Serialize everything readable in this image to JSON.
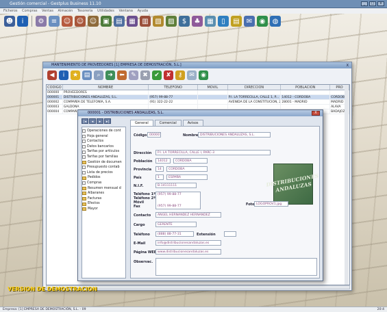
{
  "app": {
    "title": "Gestión comercial - Gestplus Business 11.10",
    "menu": [
      "Ficheros",
      "Compras",
      "Ventas",
      "Almacén",
      "Tesorería",
      "Utilidades",
      "Ventana",
      "Ayuda"
    ]
  },
  "list_window": {
    "title": "MANTENIMIENTO DE PROVEEDORES     [1] EMPRESA DE DEMOSTRACIÓN, S.L.]",
    "close": "X",
    "columns": [
      "CODIGO",
      "NOMBRE",
      "TELEFONO",
      "MOVIL",
      "DIRECCION",
      "POBLACION",
      "PRO"
    ],
    "rows": [
      [
        "000000",
        "PROVEEDORES",
        "",
        "",
        "",
        "",
        ""
      ],
      [
        "000001",
        "DISTRIBUCIONES ANDALUZAS, S.L.",
        "(957) 99-88-77",
        "",
        "P.I. LA TORRECILLA, CALLE 1, P...",
        "14012 - CORDOBA",
        "CORDOBA"
      ],
      [
        "000002",
        "COMPAÑÍA DE TELEFONÍA, S.A.",
        "(91) 322-22-22",
        "",
        "AVENIDA DE LA CONSTITUCION, 2",
        "28001 - MADRID",
        "MADRID"
      ],
      [
        "000003",
        "GALDONA",
        "",
        "",
        "",
        "",
        "ALAVA"
      ],
      [
        "000004",
        "COMPAÑ",
        "",
        "",
        "",
        "",
        "BADAJOZ"
      ]
    ]
  },
  "detail_window": {
    "title": "000001 - DISTRIBUCIONES ANDALUZAS, S.L.",
    "close": "X",
    "nav": [
      "|◂",
      "◂",
      "▸",
      "▸|"
    ],
    "tabs": [
      "General",
      "Comercial",
      "Avisos"
    ],
    "tree": [
      {
        "label": "Operaciones de cont",
        "type": "doc"
      },
      {
        "label": "Hoja general",
        "type": "doc"
      },
      {
        "label": "Contactos",
        "type": "doc"
      },
      {
        "label": "Datos bancarios",
        "type": "doc"
      },
      {
        "label": "Tarifas por artículos",
        "type": "doc"
      },
      {
        "label": "Tarifas por familias",
        "type": "doc"
      },
      {
        "label": "Gestión de documen",
        "type": "folder"
      },
      {
        "label": "Presupuesto contab",
        "type": "doc"
      },
      {
        "label": "Lista de precios",
        "type": "doc"
      },
      {
        "label": "Pedidos",
        "type": "folder"
      },
      {
        "label": "Compras",
        "type": "doc"
      },
      {
        "label": "Resumen mensual d",
        "type": "folder"
      },
      {
        "label": "Albaranes",
        "type": "folder"
      },
      {
        "label": "Facturas",
        "type": "folder"
      },
      {
        "label": "Efectos",
        "type": "folder"
      },
      {
        "label": "Mayor",
        "type": "folder"
      }
    ],
    "fields": {
      "codigo_label": "Código",
      "codigo": "000001",
      "nombre_label": "Nombre",
      "nombre": "DISTRIBUCIONES ANDALUZAS, S.L.",
      "direccion_label": "Dirección",
      "direccion": "P.I. LA TORRECILLA, CALLE I, PARC-3",
      "poblacion_label": "Población",
      "cp": "14012",
      "poblacion": "CORDOBA",
      "provincia_label": "Provincia",
      "prov_code": "14",
      "provincia": "CORDOBA",
      "pais_label": "País",
      "pais_code": "1",
      "pais": "ESPAÑA",
      "nif_label": "N.I.F.",
      "nif": "B-14111111",
      "tel1_label": "Teléfono 1º",
      "tel2_label": "Teléfono 2º",
      "movil_label": "Móvil",
      "fax_label": "Fax",
      "tel1": "(957) 99-88-77",
      "fax": "(957) 99-88-77",
      "foto_label": "Foto",
      "foto": "LOGOPROV1.jpg",
      "contacto_label": "Contacto",
      "contacto": "ANGEL HERNANDEZ HERNANDEZ",
      "cargo_label": "Cargo",
      "cargo": "GERENTE",
      "telefono_label": "Teléfono",
      "telefono": "(888) 88-77-31",
      "extension_label": "Extensión",
      "email_label": "E-Mail",
      "email": "info@distribucionesandaluzas.es",
      "web_label": "Página WEB",
      "web": "www.distribucionesandaluzas.es",
      "obs_label": "Observac."
    },
    "logo_text": "DISTRIBUCIONES ANDALUZAS"
  },
  "watermark": "VERSION DE DEMOSTRACION",
  "status": {
    "left": "Empresa:   [1] EMPRESA DE DEMOSTRACIÓN, S.L.  -  09",
    "right": "20:4"
  }
}
